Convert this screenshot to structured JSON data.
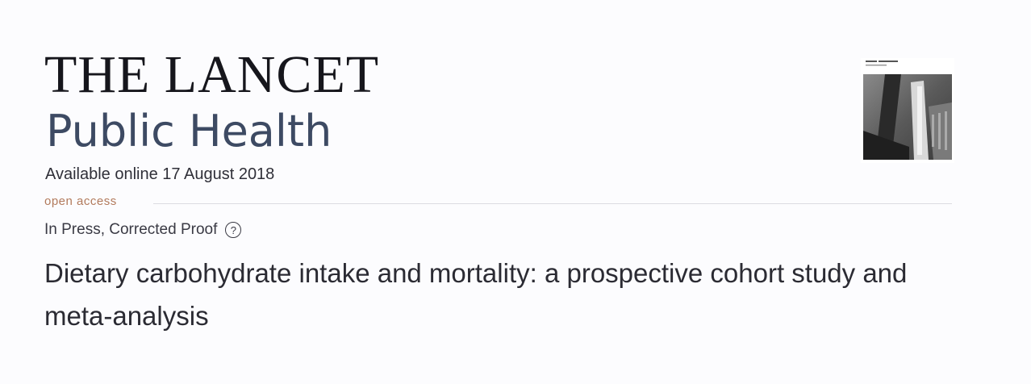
{
  "journal": {
    "name": "THE LANCET",
    "subtitle": "Public Health"
  },
  "article": {
    "available": "Available online 17 August 2018",
    "access": "open access",
    "status": "In Press, Corrected Proof",
    "help_icon_glyph": "?",
    "title": "Dietary carbohydrate intake and mortality: a prospective cohort study and meta-analysis"
  },
  "cover": {
    "icon": "journal-cover-thumbnail"
  }
}
